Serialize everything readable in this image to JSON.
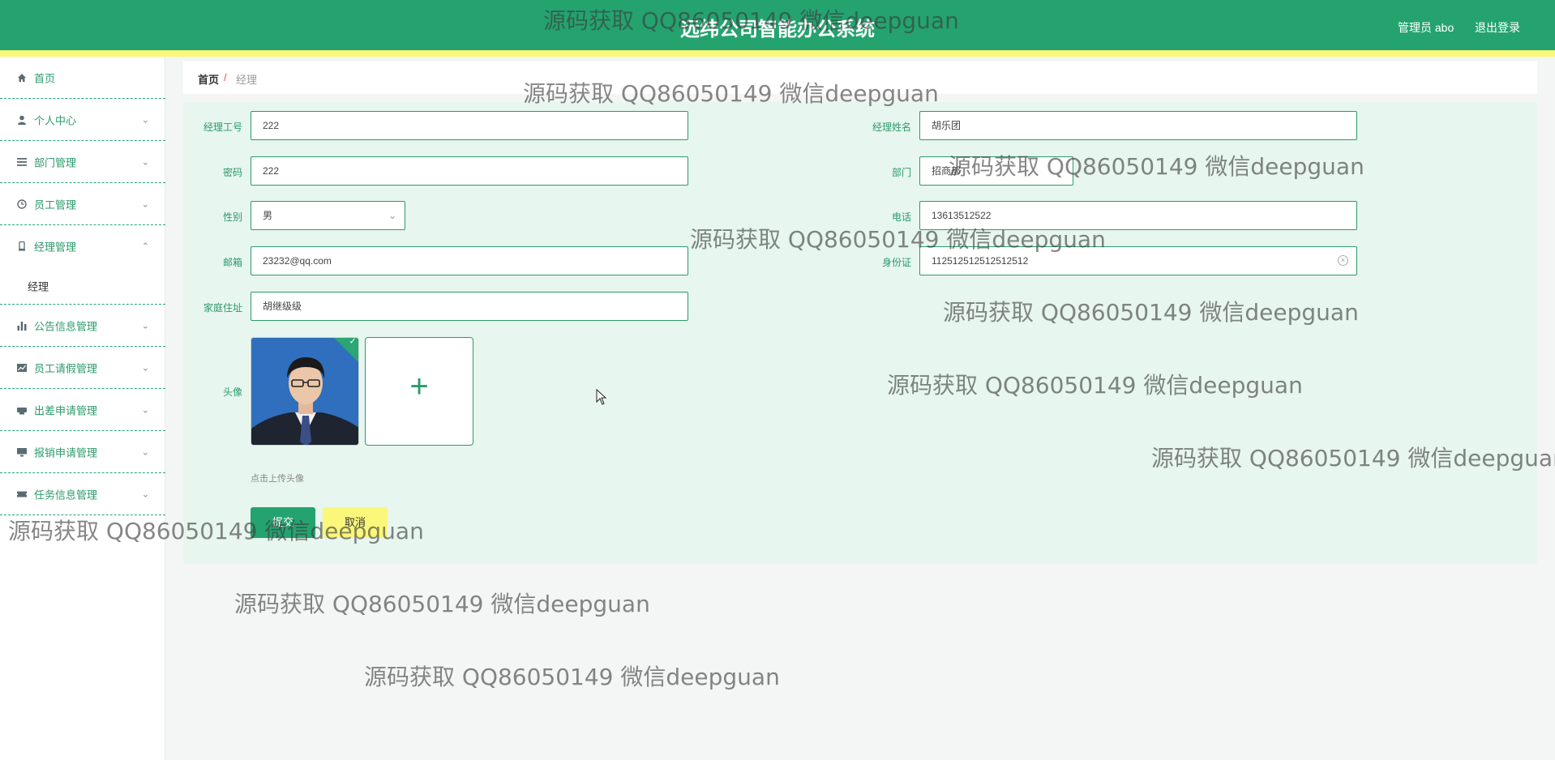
{
  "header": {
    "title": "远纬公司智能办公系统",
    "user_label": "管理员 abo",
    "logout_label": "退出登录"
  },
  "sidebar": {
    "items": [
      {
        "label": "首页",
        "icon": "home-icon"
      },
      {
        "label": "个人中心",
        "icon": "user-icon"
      },
      {
        "label": "部门管理",
        "icon": "list-icon"
      },
      {
        "label": "员工管理",
        "icon": "clock-icon"
      },
      {
        "label": "经理管理",
        "icon": "badge-icon"
      },
      {
        "label": "公告信息管理",
        "icon": "bar-chart-icon"
      },
      {
        "label": "员工请假管理",
        "icon": "line-chart-icon"
      },
      {
        "label": "出差申请管理",
        "icon": "printer-icon"
      },
      {
        "label": "报销申请管理",
        "icon": "monitor-icon"
      },
      {
        "label": "任务信息管理",
        "icon": "ticket-icon"
      }
    ],
    "submenu": {
      "label": "经理"
    }
  },
  "breadcrumb": {
    "home": "首页",
    "separator": "/",
    "current": "经理"
  },
  "form": {
    "manager_no": {
      "label": "经理工号",
      "value": "222"
    },
    "manager_name": {
      "label": "经理姓名",
      "value": "胡乐团"
    },
    "password": {
      "label": "密码",
      "value": "222"
    },
    "department": {
      "label": "部门",
      "value": "招商部"
    },
    "gender": {
      "label": "性别",
      "value": "男"
    },
    "phone": {
      "label": "电话",
      "value": "13613512522"
    },
    "email": {
      "label": "邮箱",
      "value": "23232@qq.com"
    },
    "id_card": {
      "label": "身份证",
      "value": "112512512512512512"
    },
    "address": {
      "label": "家庭住址",
      "value": "胡继级级"
    },
    "avatar": {
      "label": "头像",
      "hint": "点击上传头像"
    },
    "submit_label": "提交",
    "cancel_label": "取消"
  },
  "watermark_text": "源码获取 QQ86050149 微信deepguan",
  "colors": {
    "primary": "#24a36f",
    "accent_yellow": "#fbf77a",
    "panel_bg": "#e7f6ef"
  }
}
